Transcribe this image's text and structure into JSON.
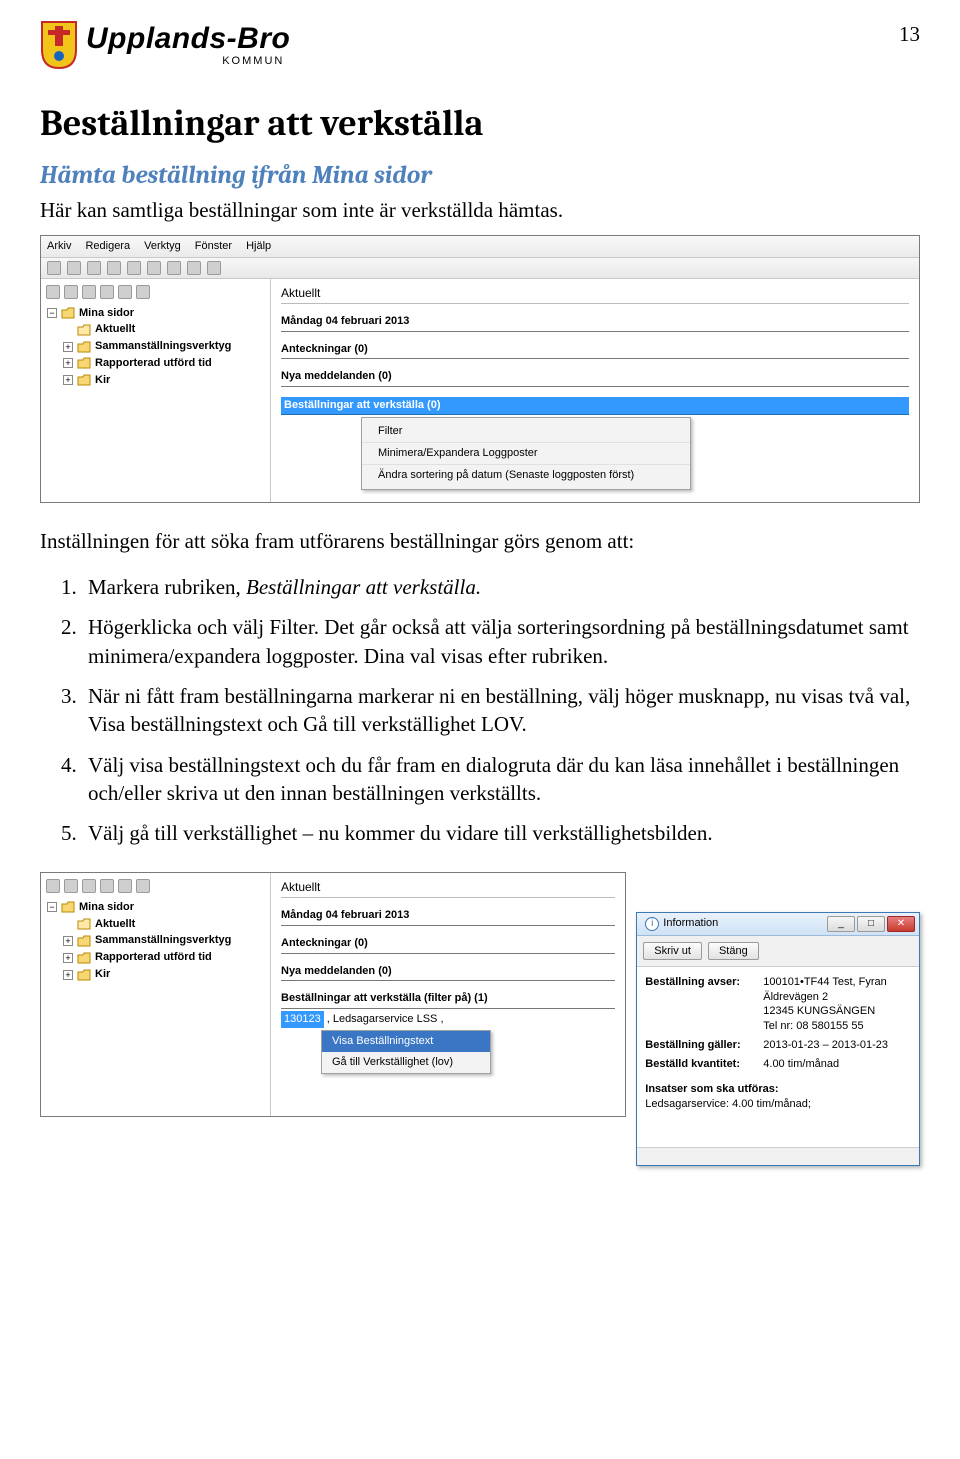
{
  "page_number": "13",
  "brand": {
    "main": "Upplands-Bro",
    "sub": "KOMMUN"
  },
  "h1": "Beställningar att verkställa",
  "h2": "Hämta beställning ifrån Mina sidor",
  "intro": "Här kan samtliga beställningar som inte är verkställda hämtas.",
  "screenshot1": {
    "menubar": [
      "Arkiv",
      "Redigera",
      "Verktyg",
      "Fönster",
      "Hjälp"
    ],
    "tree": {
      "root": "Mina sidor",
      "items": [
        "Aktuellt",
        "Sammanställningsverktyg",
        "Rapporterad utförd tid",
        "Kir"
      ]
    },
    "panel_title": "Aktuellt",
    "date_line": "Måndag 04 februari 2013",
    "anteckningar": "Anteckningar    (0)",
    "meddelanden": "Nya meddelanden    (0)",
    "best_header": "Beställningar att verkställa    (0)",
    "context": [
      "Filter",
      "Minimera/Expandera Loggposter",
      "Ändra sortering på datum (Senaste loggposten först)"
    ]
  },
  "paragraph_between": "Inställningen för att söka fram utförarens beställningar görs genom att:",
  "steps": [
    {
      "text_a": "Markera rubriken, ",
      "em": "Beställningar att verkställa.",
      "text_b": ""
    },
    {
      "text_a": "Högerklicka och välj Filter. Det går också att välja sorteringsordning på beställningsdatumet samt minimera/expandera loggposter. Dina val visas efter rubriken.",
      "em": "",
      "text_b": ""
    },
    {
      "text_a": "När ni fått fram beställningarna markerar ni en beställning, välj höger musknapp, nu visas två val, Visa beställningstext och Gå till verkställighet LOV.",
      "em": "",
      "text_b": ""
    },
    {
      "text_a": "Välj visa beställningstext och du får fram en dialogruta där du kan läsa innehållet i beställningen och/eller skriva ut den innan beställningen verkställts.",
      "em": "",
      "text_b": ""
    },
    {
      "text_a": "Välj gå till verkställighet – nu kommer du vidare till verkställighetsbilden.",
      "em": "",
      "text_b": ""
    }
  ],
  "screenshot2": {
    "tree": {
      "root": "Mina sidor",
      "items": [
        "Aktuellt",
        "Sammanställningsverktyg",
        "Rapporterad utförd tid",
        "Kir"
      ]
    },
    "panel_title": "Aktuellt",
    "date_line": "Måndag 04 februari 2013",
    "anteckningar": "Anteckningar    (0)",
    "meddelanden": "Nya meddelanden    (0)",
    "best_header": "Beställningar att verkställa    (filter på)    (1)",
    "order_sel": "130123",
    "order_tail": ", Ledsagarservice LSS ,",
    "ctx": [
      "Visa Beställningstext",
      "Gå till Verkställighet (lov)"
    ]
  },
  "modal": {
    "title": "Information",
    "btn_print": "Skriv ut",
    "btn_close": "Stäng",
    "rows": [
      {
        "k": "Beställning avser:",
        "v": "100101•TF44  Test, Fyran\nÄldrevägen 2\n12345 KUNGSÄNGEN\nTel nr: 08 580155 55"
      },
      {
        "k": "Beställning gäller:",
        "v": "2013-01-23 – 2013-01-23"
      },
      {
        "k": "Beställd kvantitet:",
        "v": "4.00 tim/månad"
      }
    ],
    "insats_head": "Insatser som ska utföras:",
    "insats_line": "Ledsagarservice: 4.00 tim/månad;"
  }
}
